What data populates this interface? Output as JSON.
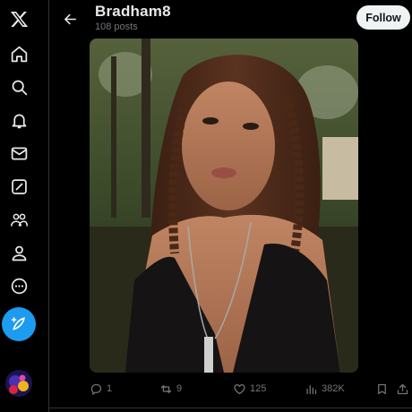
{
  "header": {
    "title": "Bradham8",
    "subtitle": "108 posts",
    "follow_label": "Follow"
  },
  "nav": [
    {
      "icon": "x-logo-icon"
    },
    {
      "icon": "home-icon"
    },
    {
      "icon": "search-icon"
    },
    {
      "icon": "notifications-icon"
    },
    {
      "icon": "messages-icon"
    },
    {
      "icon": "grok-icon"
    },
    {
      "icon": "communities-icon"
    },
    {
      "icon": "profile-icon"
    },
    {
      "icon": "more-icon"
    }
  ],
  "actions": {
    "replies": "1",
    "reposts": "9",
    "likes": "125",
    "views": "382K"
  },
  "colors": {
    "accent": "#1d9bf0",
    "background": "#000000",
    "muted": "#71767b",
    "text": "#e7e9ea"
  }
}
